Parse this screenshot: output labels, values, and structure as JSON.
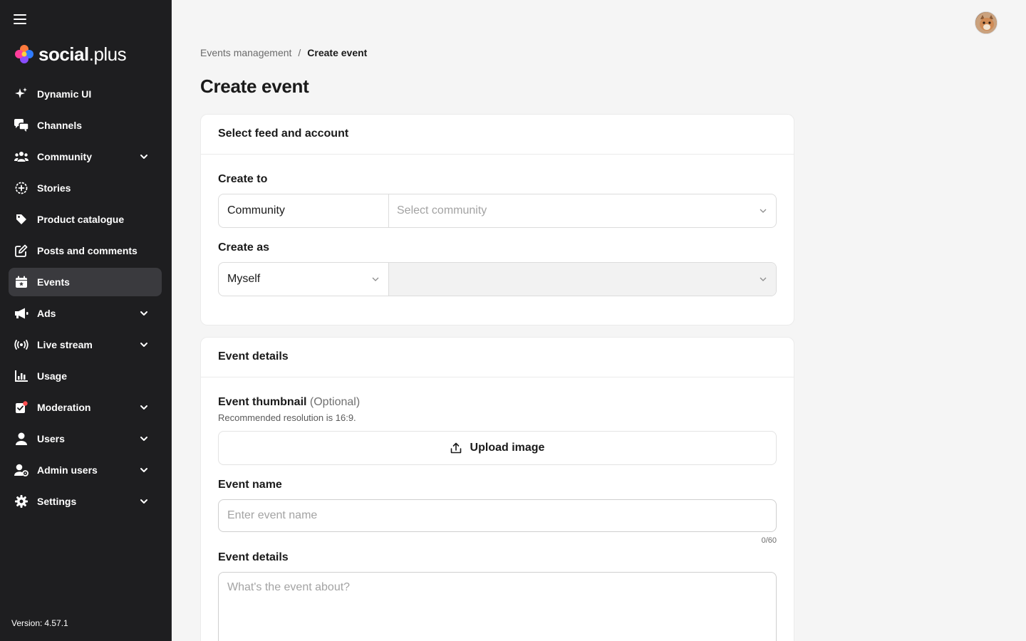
{
  "brand": {
    "name_bold": "social",
    "name_thin": ".plus"
  },
  "sidebar": {
    "items": [
      {
        "label": "Dynamic UI",
        "icon": "sparkles-icon",
        "expandable": false,
        "active": false
      },
      {
        "label": "Channels",
        "icon": "chat-bubbles-icon",
        "expandable": false,
        "active": false
      },
      {
        "label": "Community",
        "icon": "users-group-icon",
        "expandable": true,
        "active": false
      },
      {
        "label": "Stories",
        "icon": "story-circle-icon",
        "expandable": false,
        "active": false
      },
      {
        "label": "Product catalogue",
        "icon": "tag-icon",
        "expandable": false,
        "active": false
      },
      {
        "label": "Posts and comments",
        "icon": "edit-square-icon",
        "expandable": false,
        "active": false
      },
      {
        "label": "Events",
        "icon": "calendar-star-icon",
        "expandable": false,
        "active": true
      },
      {
        "label": "Ads",
        "icon": "megaphone-icon",
        "expandable": true,
        "active": false
      },
      {
        "label": "Live stream",
        "icon": "broadcast-icon",
        "expandable": true,
        "active": false
      },
      {
        "label": "Usage",
        "icon": "bar-chart-icon",
        "expandable": false,
        "active": false
      },
      {
        "label": "Moderation",
        "icon": "moderation-check-icon",
        "expandable": true,
        "active": false
      },
      {
        "label": "Users",
        "icon": "user-icon",
        "expandable": true,
        "active": false
      },
      {
        "label": "Admin users",
        "icon": "admin-user-icon",
        "expandable": true,
        "active": false
      },
      {
        "label": "Settings",
        "icon": "gear-icon",
        "expandable": true,
        "active": false
      }
    ],
    "version_label": "Version:",
    "version_value": "4.57.1"
  },
  "breadcrumb": {
    "parent": "Events management",
    "separator": "/",
    "current": "Create event"
  },
  "page_title": "Create event",
  "feed_card": {
    "title": "Select feed and account",
    "create_to": {
      "label": "Create to",
      "type_value": "Community",
      "target_placeholder": "Select community"
    },
    "create_as": {
      "label": "Create as",
      "type_value": "Myself",
      "target_value": ""
    }
  },
  "details_card": {
    "title": "Event details",
    "thumbnail": {
      "label": "Event thumbnail",
      "optional": "(Optional)",
      "hint": "Recommended resolution is 16:9.",
      "upload_label": "Upload image"
    },
    "name": {
      "label": "Event name",
      "placeholder": "Enter event name",
      "counter": "0/60"
    },
    "details": {
      "label": "Event details",
      "placeholder": "What's the event about?"
    }
  },
  "colors": {
    "sidebar_bg": "#1e1e20",
    "active_item_bg": "#3a3a3e",
    "page_bg": "#f5f5f5",
    "alert_dot": "#ff4d4f"
  }
}
